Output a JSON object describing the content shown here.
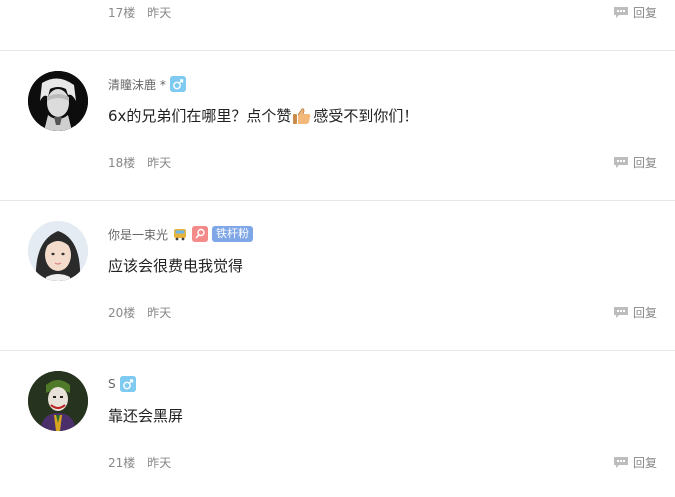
{
  "comments": [
    {
      "floor": "17楼",
      "time": "昨天",
      "reply": "回复"
    },
    {
      "username": "清瞳沫鹿 *",
      "content_before": "6x的兄弟们在哪里？点个赞",
      "content_after": "感受不到你们！",
      "floor": "18楼",
      "time": "昨天",
      "reply": "回复"
    },
    {
      "username": "你是一束光",
      "fan_badge": "铁杆粉",
      "content": "应该会很费电我觉得",
      "floor": "20楼",
      "time": "昨天",
      "reply": "回复"
    },
    {
      "username": "S",
      "content": "靠还会黑屏",
      "floor": "21楼",
      "time": "昨天",
      "reply": "回复"
    }
  ],
  "colors": {
    "gender_badge": "#7ecaf0",
    "fan_badge": "#7fa6e6",
    "pin_badge": "#f58a8a",
    "meta_text": "#888888",
    "divider": "#e6e6e6"
  },
  "icons": {
    "gender": "male-icon",
    "thumbs_up": "thumbs-up-emoji",
    "reply": "comment-bubble-icon",
    "bus": "bus-emoji",
    "pin": "search-pin-icon"
  }
}
